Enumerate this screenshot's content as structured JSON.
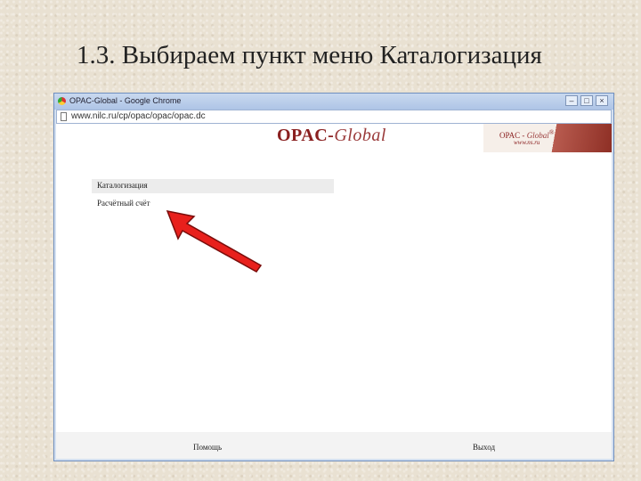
{
  "slide": {
    "title": "1.3. Выбираем пункт меню Каталогизация"
  },
  "window": {
    "title": "OPAC-Global - Google Chrome",
    "buttons": {
      "minimize": "–",
      "maximize": "□",
      "close": "×"
    }
  },
  "address": {
    "url": "www.nilc.ru/cp/opac/opac/opac.dc"
  },
  "banner": {
    "logo_main": "OPAC-",
    "logo_italic": "Global",
    "brand_main": "OPAC - ",
    "brand_italic": "Global",
    "brand_mark": "®",
    "site": "www.ns.ru"
  },
  "menu": {
    "items": [
      "Каталогизация",
      "Расчётный счёт"
    ]
  },
  "footer": {
    "help": "Помощь",
    "exit": "Выход"
  },
  "colors": {
    "arrow": "#e8201c",
    "accent": "#8a2020"
  }
}
